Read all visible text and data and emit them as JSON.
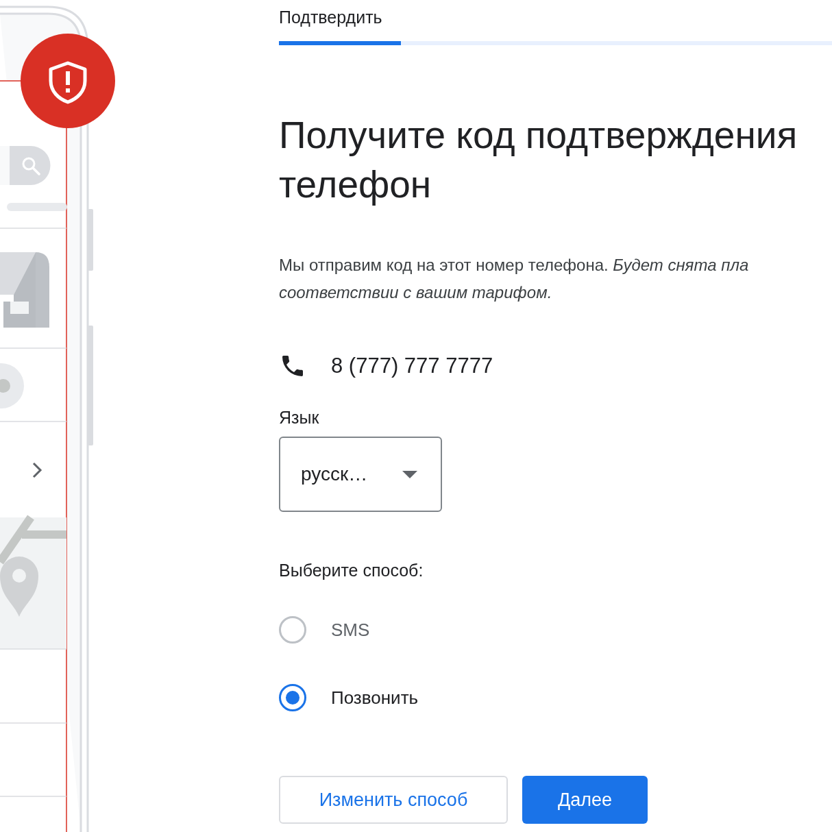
{
  "step": {
    "label": "Подтвердить",
    "level": 0.22
  },
  "heading": [
    "Получите код подтверждения",
    "телефон"
  ],
  "description": [
    "Мы отправим код на этот номер телефона. *Будет снята пла*",
    "*соответствии с вашим тарифом.*"
  ],
  "phone_number": "8 (777) 777 7777",
  "language": {
    "label": "Язык",
    "value": "русск…"
  },
  "method": {
    "label": "Выберите способ:",
    "options": [
      {
        "label": "SMS",
        "selected": false
      },
      {
        "label": "Позвонить",
        "selected": true
      }
    ]
  },
  "buttons": [
    {
      "label": "Изменить способ",
      "kind": "outlined"
    },
    {
      "label": "Далее",
      "kind": "primary"
    }
  ]
}
